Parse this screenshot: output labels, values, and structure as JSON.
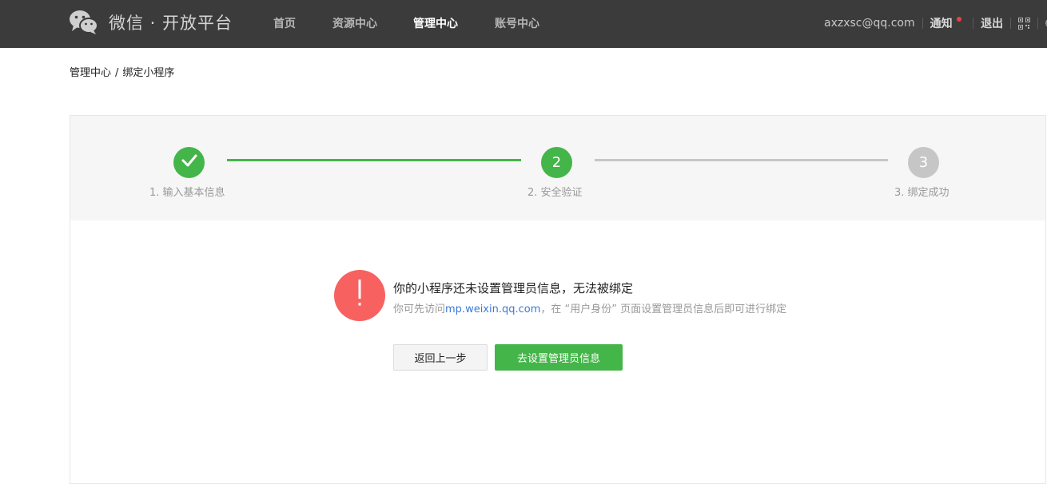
{
  "header": {
    "logo_text": "微信 · 开放平台",
    "nav": [
      "首页",
      "资源中心",
      "管理中心",
      "账号中心"
    ],
    "active_nav_index": 2,
    "user_email": "axzxsc@qq.com",
    "notice_label": "通知",
    "logout_label": "退出",
    "icons": [
      "wechat-logo",
      "qrcode-icon",
      "globe-icon"
    ]
  },
  "breadcrumb": {
    "items": [
      "管理中心",
      "绑定小程序"
    ],
    "separator": "/"
  },
  "steps": {
    "items": [
      {
        "label": "1. 输入基本信息",
        "state": "done",
        "number": ""
      },
      {
        "label": "2. 安全验证",
        "state": "current",
        "number": "2"
      },
      {
        "label": "3. 绑定成功",
        "state": "todo",
        "number": "3"
      }
    ],
    "colors": {
      "done": "#44b549",
      "todo": "#c6c6c6"
    }
  },
  "message": {
    "title": "你的小程序还未设置管理员信息，无法被绑定",
    "desc_prefix": "你可先访问",
    "link_text": "mp.weixin.qq.com",
    "desc_suffix": "，在 “用户身份” 页面设置管理员信息后即可进行绑定",
    "icon": "exclamation-icon",
    "icon_color": "#f76260"
  },
  "buttons": {
    "back_label": "返回上一步",
    "primary_label": "去设置管理员信息",
    "primary_color": "#44b549"
  }
}
